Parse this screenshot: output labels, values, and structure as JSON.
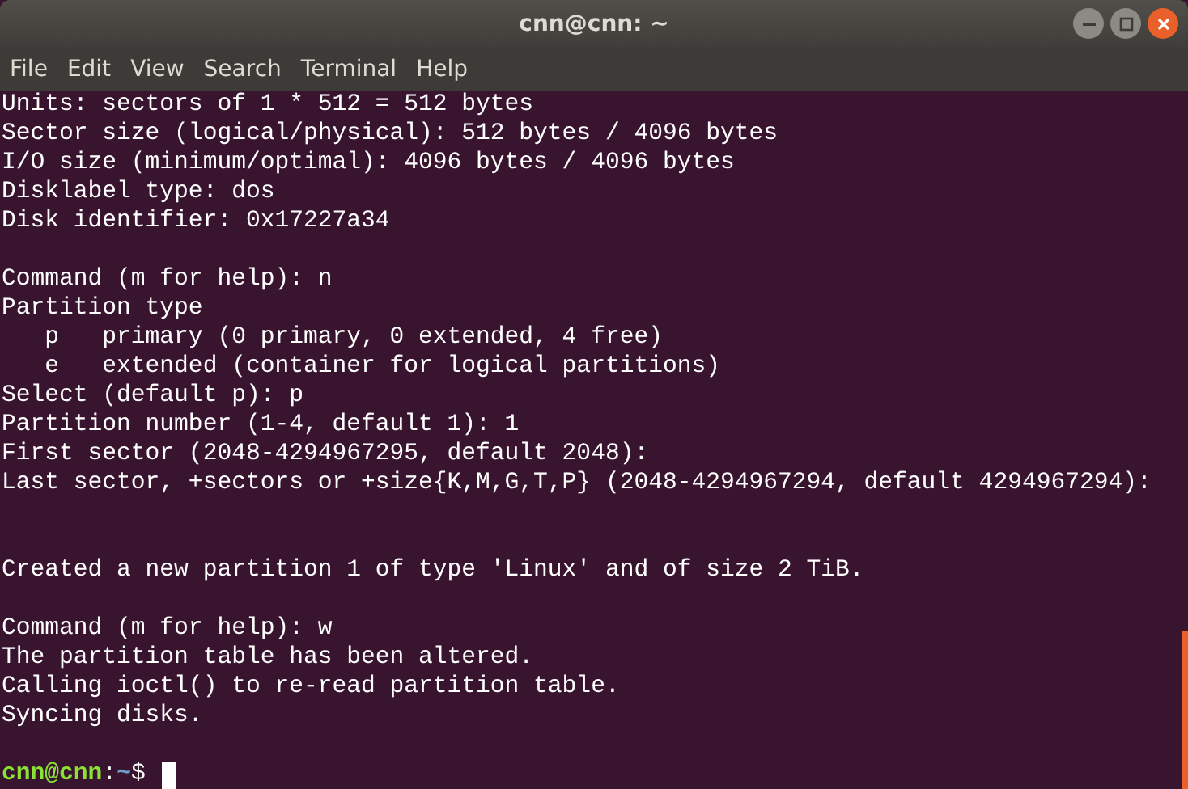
{
  "window": {
    "title": "cnn@cnn: ~"
  },
  "menu": [
    "File",
    "Edit",
    "View",
    "Search",
    "Terminal",
    "Help"
  ],
  "terminal": {
    "lines": [
      {
        "kind": "text",
        "text": "Units: sectors of 1 * 512 = 512 bytes"
      },
      {
        "kind": "text",
        "text": "Sector size (logical/physical): 512 bytes / 4096 bytes"
      },
      {
        "kind": "text",
        "text": "I/O size (minimum/optimal): 4096 bytes / 4096 bytes"
      },
      {
        "kind": "text",
        "text": "Disklabel type: dos"
      },
      {
        "kind": "text",
        "text": "Disk identifier: 0x17227a34"
      },
      {
        "kind": "blank"
      },
      {
        "kind": "text",
        "text": "Command (m for help): n"
      },
      {
        "kind": "text",
        "text": "Partition type"
      },
      {
        "kind": "text",
        "text": "   p   primary (0 primary, 0 extended, 4 free)"
      },
      {
        "kind": "text",
        "text": "   e   extended (container for logical partitions)"
      },
      {
        "kind": "text",
        "text": "Select (default p): p"
      },
      {
        "kind": "text",
        "text": "Partition number (1-4, default 1): 1"
      },
      {
        "kind": "text",
        "text": "First sector (2048-4294967295, default 2048):"
      },
      {
        "kind": "text",
        "text": "Last sector, +sectors or +size{K,M,G,T,P} (2048-4294967294, default 4294967294):"
      },
      {
        "kind": "blank"
      },
      {
        "kind": "blank"
      },
      {
        "kind": "text",
        "text": "Created a new partition 1 of type 'Linux' and of size 2 TiB."
      },
      {
        "kind": "blank"
      },
      {
        "kind": "text",
        "text": "Command (m for help): w"
      },
      {
        "kind": "text",
        "text": "The partition table has been altered."
      },
      {
        "kind": "text",
        "text": "Calling ioctl() to re-read partition table."
      },
      {
        "kind": "text",
        "text": "Syncing disks."
      },
      {
        "kind": "blank"
      },
      {
        "kind": "prompt",
        "user_host": "cnn@cnn",
        "separator": ":",
        "path": "~",
        "symbol": "$"
      }
    ]
  }
}
